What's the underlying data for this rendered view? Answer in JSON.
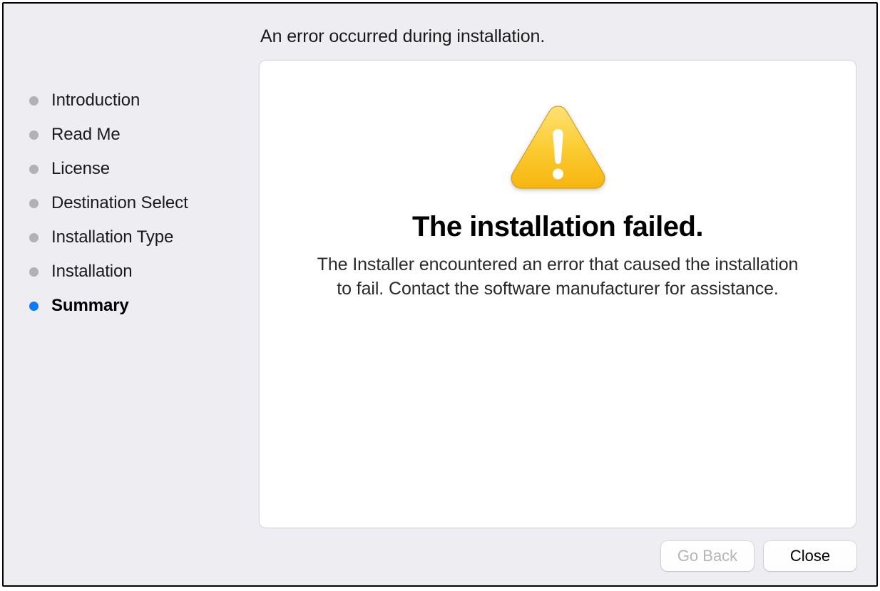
{
  "header": {
    "title": "An error occurred during installation."
  },
  "sidebar": {
    "steps": [
      {
        "label": "Introduction",
        "active": false
      },
      {
        "label": "Read Me",
        "active": false
      },
      {
        "label": "License",
        "active": false
      },
      {
        "label": "Destination Select",
        "active": false
      },
      {
        "label": "Installation Type",
        "active": false
      },
      {
        "label": "Installation",
        "active": false
      },
      {
        "label": "Summary",
        "active": true
      }
    ]
  },
  "main": {
    "fail_title": "The installation failed.",
    "fail_description": "The Installer encountered an error that caused the installation to fail. Contact the software manufacturer for assistance."
  },
  "footer": {
    "go_back_label": "Go Back",
    "close_label": "Close"
  }
}
